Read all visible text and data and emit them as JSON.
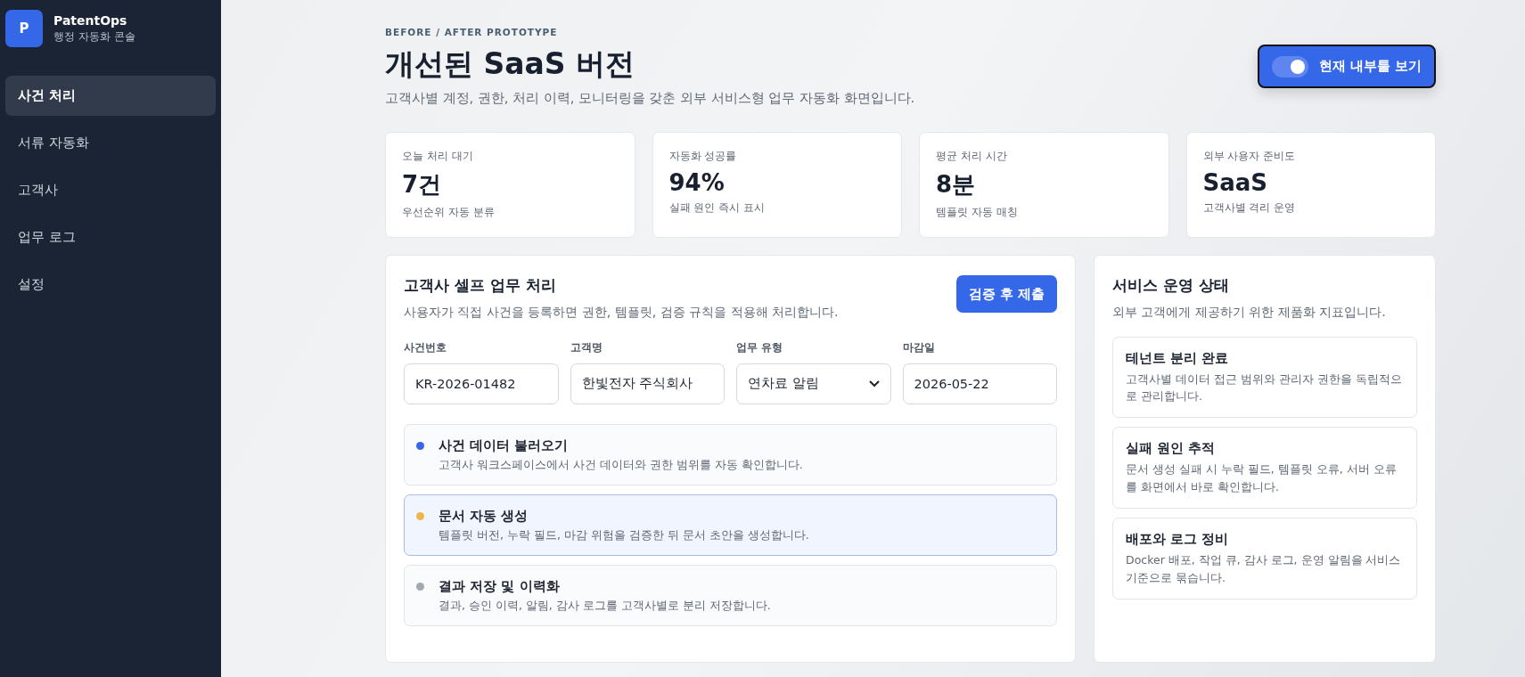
{
  "sidebar": {
    "logo_letter": "P",
    "brand": "PatentOps",
    "subtitle": "행정 자동화 콘솔",
    "items": [
      {
        "label": "사건 처리",
        "selected": true
      },
      {
        "label": "서류 자동화",
        "selected": false
      },
      {
        "label": "고객사",
        "selected": false
      },
      {
        "label": "업무 로그",
        "selected": false
      },
      {
        "label": "설정",
        "selected": false
      }
    ]
  },
  "header": {
    "eyebrow": "BEFORE / AFTER PROTOTYPE",
    "title": "개선된 SaaS 버전",
    "description": "고객사별 계정, 권한, 처리 이력, 모니터링을 갖춘 외부 서비스형 업무 자동화 화면입니다.",
    "toggle": {
      "label": "현재 내부툴 보기",
      "on": true
    }
  },
  "stats": [
    {
      "label": "오늘 처리 대기",
      "value": "7건",
      "note": "우선순위 자동 분류"
    },
    {
      "label": "자동화 성공률",
      "value": "94%",
      "note": "실패 원인 즉시 표시"
    },
    {
      "label": "평균 처리 시간",
      "value": "8분",
      "note": "템플릿 자동 매칭"
    },
    {
      "label": "외부 사용자 준비도",
      "value": "SaaS",
      "note": "고객사별 격리 운영"
    }
  ],
  "workflow": {
    "title": "고객사 셀프 업무 처리",
    "description": "사용자가 직접 사건을 등록하면 권한, 템플릿, 검증 규칙을 적용해 처리합니다.",
    "submit": "검증 후 제출",
    "fields": [
      {
        "kind": "text",
        "label": "사건번호",
        "value": "KR-2026-01482"
      },
      {
        "kind": "text",
        "label": "고객명",
        "value": "한빛전자 주식회사"
      },
      {
        "kind": "select",
        "label": "업무 유형",
        "value": "연차료 알림"
      },
      {
        "kind": "text",
        "label": "마감일",
        "value": "2026-05-22"
      }
    ],
    "steps": [
      {
        "title": "사건 데이터 불러오기",
        "description": "고객사 워크스페이스에서 사건 데이터와 권한 범위를 자동 확인합니다.",
        "color": "#3468e8",
        "selected": false
      },
      {
        "title": "문서 자동 생성",
        "description": "템플릿 버전, 누락 필드, 마감 위험을 검증한 뒤 문서 초안을 생성합니다.",
        "color": "#f0b44c",
        "selected": true
      },
      {
        "title": "결과 저장 및 이력화",
        "description": "결과, 승인 이력, 알림, 감사 로그를 고객사별로 분리 저장합니다.",
        "color": "#a3a9b1",
        "selected": false
      }
    ]
  },
  "service": {
    "title": "서비스 운영 상태",
    "description": "외부 고객에게 제공하기 위한 제품화 지표입니다.",
    "items": [
      {
        "title": "테넌트 분리 완료",
        "description": "고객사별 데이터 접근 범위와 관리자 권한을 독립적으로 관리합니다."
      },
      {
        "title": "실패 원인 추적",
        "description": "문서 생성 실패 시 누락 필드, 템플릿 오류, 서버 오류를 화면에서 바로 확인합니다."
      },
      {
        "title": "배포와 로그 정비",
        "description": "Docker 배포, 작업 큐, 감사 로그, 운영 알림을 서비스 기준으로 묶습니다."
      }
    ]
  }
}
